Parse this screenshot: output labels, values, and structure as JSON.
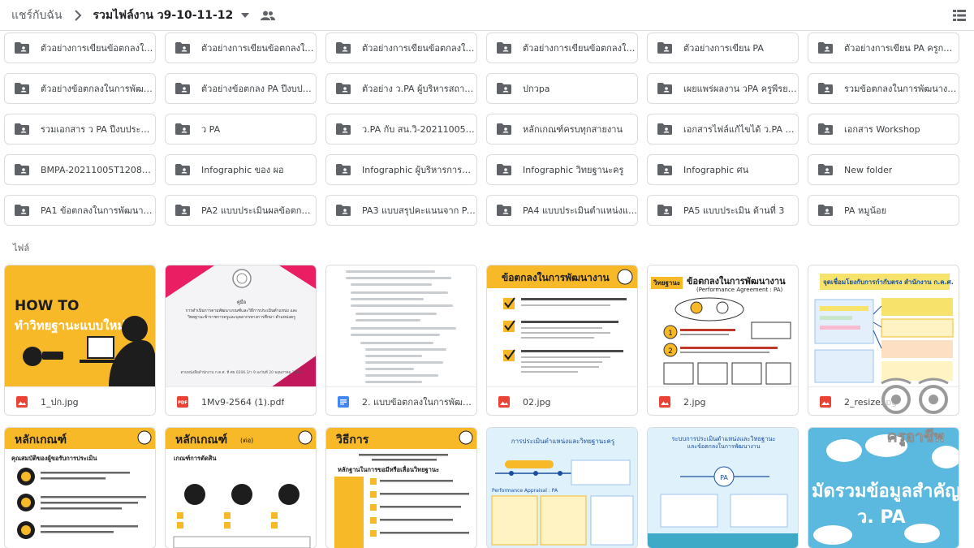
{
  "breadcrumb": {
    "root": "แชร์กับฉัน",
    "current": "รวมไฟล์งาน ว9-10-11-12"
  },
  "folders": [
    "ตัวอย่างการเขียนข้อตกลงในก...",
    "ตัวอย่างการเขียนข้อตกลงในก...",
    "ตัวอย่างการเขียนข้อตกลงในก...",
    "ตัวอย่างการเขียนข้อตกลงในก...",
    "ตัวอย่างการเขียน PA",
    "ตัวอย่างการเขียน PA ครูกณิตลด...",
    "ตัวอย่างข้อตกลงในการพัฒนา...",
    "ตัวอย่างข้อตกลง PA ปีงบประม...",
    "ตัวอย่าง ว.PA ผู้บริหารสถานศึ...",
    "ปกวpa",
    "เผยแพร่ผลงาน วPA ครูพีรยา แ...",
    "รวมข้อตกลงในการพัฒนางาน ...",
    "รวมเอกสาร ว PA ปีงบประมาณ...",
    "ว PA",
    "ว.PA กับ สน.วิ-20211005T12...",
    "หลักเกณฑ์ครบทุกสายงาน",
    "เอกสารไฟล์แก้ไขได้ ว.PA ครูว...",
    "เอกสาร Workshop",
    "BMPA-20211005T120800Z...",
    "Infographic ของ ผอ",
    "Infographic ผู้บริหารการศึกษา",
    "Infographic วิทยฐานะครู",
    "Infographic ศน",
    "New folder",
    "PA1 ข้อตกลงในการพัฒนางาน",
    "PA2 แบบประเมินผลข้อตกลงใ...",
    "PA3 แบบสรุปคะแนนจาก PA2",
    "PA4 แบบประเมินตำแหน่งและ...",
    "PA5 แบบประเมิน ด้านที่ 3",
    "PA หมูน้อย"
  ],
  "files_section_label": "ไฟล์",
  "files": [
    {
      "name": "1_ปก.jpg",
      "type": "image"
    },
    {
      "name": "1Mv9-2564 (1).pdf",
      "type": "pdf"
    },
    {
      "name": "2. แบบข้อตกลงในการพัฒนาง...",
      "type": "doc"
    },
    {
      "name": "02.jpg",
      "type": "image"
    },
    {
      "name": "2.jpg",
      "type": "image"
    },
    {
      "name": "2_resize.jpg",
      "type": "image"
    }
  ],
  "thumb_text": {
    "howto_1": "HOW TO",
    "howto_2": "ทำวิทยฐานะแบบใหม่",
    "pdf_title": "คู่มือ",
    "pdf_body": "การดำเนินการตามพัฒนาเกณฑ์และวิธีการประเมินตำแหน่ง และวิทยฐานะข้าราชการครูและบุคลากรทางการศึกษา ตำแหน่งครู",
    "pdf_footer": "ตามหนังสือสำนักงาน ก.ค.ศ. ที่ ศธ 0206.3/ว 9 ลงวันที่ 20 พฤษภาคม 2564",
    "agreement_title": "ข้อตกลงในการพัฒนางาน",
    "agreement_title_2": "ข้อตกลงในการพัฒนางาน",
    "agreement_sub": "(Performance Agreement : PA)",
    "agreement_tag": "วิทยฐานะ",
    "link_title": "จุดเชื่อมโยงกับการกำกับตรง สำนักงาน ก.ค.ศ.",
    "criteria_1": "หลักเกณฑ์",
    "criteria_1_sub": "คุณสมบัติของผู้ขอรับการประเมิน",
    "criteria_2": "หลักเกณฑ์",
    "criteria_2_tag": "(ต่อ)",
    "criteria_2_sub": "เกณฑ์การตัดสิน",
    "method": "วิธีการ",
    "method_sub": "หลักฐานในการขอมีหรือเลื่อนวิทยฐานะ",
    "eval_title": "การประเมินตำแหน่งและวิทยฐานะครู",
    "eval_sub": "Performance Appraisal : PA",
    "system_title": "ระบบการประเมินตำแหน่งและวิทยฐานะ",
    "system_sub": "และข้อตกลงในการพัฒนางาน",
    "collect_1": "มัดรวมข้อมูลสำคัญ",
    "collect_2": "ว. PA",
    "watermark": "ครูอาชีพ"
  },
  "colors": {
    "folder_icon": "#5f6368",
    "pdf_red": "#ea4335",
    "doc_blue": "#4285f4",
    "image_red": "#ea4335",
    "accent_yellow": "#f7b928"
  }
}
